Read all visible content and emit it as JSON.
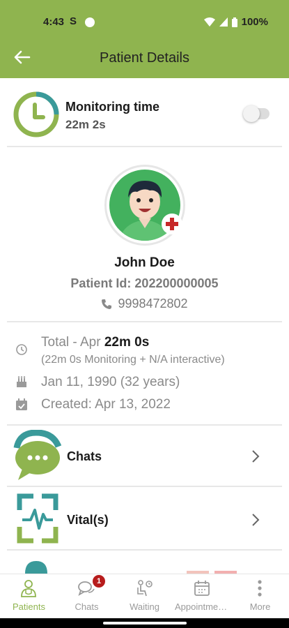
{
  "status_bar": {
    "time": "4:43",
    "s_glyph": "S",
    "battery": "100%"
  },
  "header": {
    "title": "Patient Details",
    "back_icon": "arrow-left-icon"
  },
  "monitoring": {
    "title": "Monitoring time",
    "time": "22m 2s",
    "toggle_on": false
  },
  "patient": {
    "name": "John Doe",
    "patient_id": "Patient Id: 202200000005",
    "phone": "9998472802"
  },
  "info": {
    "total_prefix": "Total - Apr ",
    "total_value": "22m 0s",
    "total_detail": "(22m 0s Monitoring + N/A interactive)",
    "dob": "Jan 11, 1990 (32 years)",
    "created": "Created: Apr 13, 2022"
  },
  "rows": [
    {
      "label": "Chats"
    },
    {
      "label": "Vital(s)"
    }
  ],
  "bottom_nav": [
    {
      "label": "Patients",
      "active": true
    },
    {
      "label": "Chats",
      "badge": "1"
    },
    {
      "label": "Waiting"
    },
    {
      "label": "Appointmen..."
    },
    {
      "label": "More"
    }
  ],
  "colors": {
    "brand_green": "#8fb44f",
    "accent_teal": "#3a9a9a",
    "badge_red": "#b71c1c"
  }
}
